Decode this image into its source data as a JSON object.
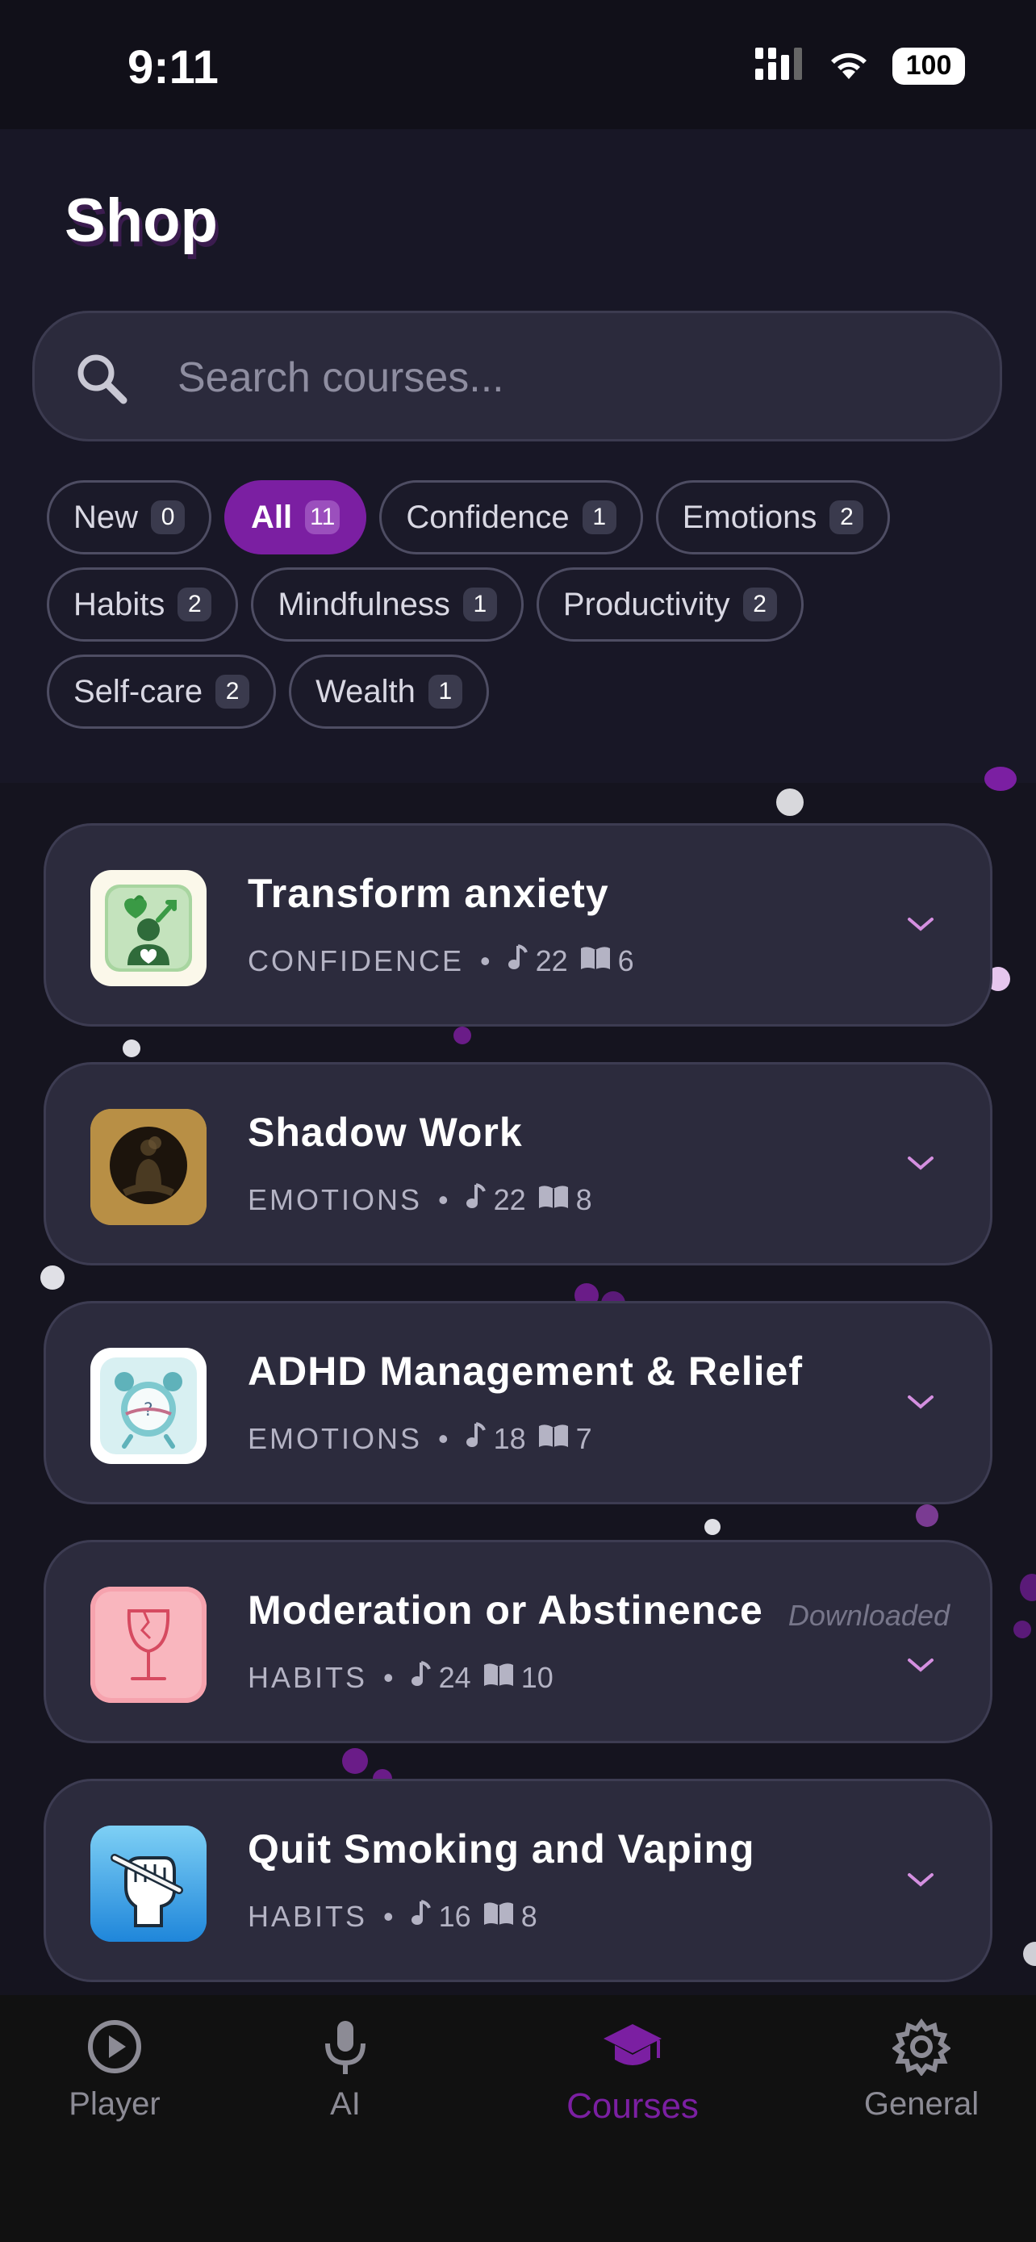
{
  "status_bar": {
    "time": "9:11",
    "battery": "100"
  },
  "page": {
    "title": "Shop"
  },
  "search": {
    "placeholder": "Search courses..."
  },
  "filters": [
    {
      "label": "New",
      "count": "0",
      "active": false
    },
    {
      "label": "All",
      "count": "11",
      "active": true
    },
    {
      "label": "Confidence",
      "count": "1",
      "active": false
    },
    {
      "label": "Emotions",
      "count": "2",
      "active": false
    },
    {
      "label": "Habits",
      "count": "2",
      "active": false
    },
    {
      "label": "Mindfulness",
      "count": "1",
      "active": false
    },
    {
      "label": "Productivity",
      "count": "2",
      "active": false
    },
    {
      "label": "Self-care",
      "count": "2",
      "active": false
    },
    {
      "label": "Wealth",
      "count": "1",
      "active": false
    }
  ],
  "courses": [
    {
      "name": "Transform anxiety",
      "category": "CONFIDENCE",
      "audio": "22",
      "reads": "6",
      "icon": "heart-growth-icon",
      "status": ""
    },
    {
      "name": "Shadow Work",
      "category": "EMOTIONS",
      "audio": "22",
      "reads": "8",
      "icon": "meditation-shadow-icon",
      "status": ""
    },
    {
      "name": "ADHD Management & Relief",
      "category": "EMOTIONS",
      "audio": "18",
      "reads": "7",
      "icon": "alarm-clock-icon",
      "status": ""
    },
    {
      "name": "Moderation or Abstinence",
      "category": "HABITS",
      "audio": "24",
      "reads": "10",
      "icon": "broken-wine-glass-icon",
      "status": "Downloaded"
    },
    {
      "name": "Quit Smoking and Vaping",
      "category": "HABITS",
      "audio": "16",
      "reads": "8",
      "icon": "fist-cigarette-icon",
      "status": ""
    }
  ],
  "tabs": [
    {
      "label": "Player",
      "icon": "play-circle-icon",
      "active": false
    },
    {
      "label": "AI",
      "icon": "microphone-icon",
      "active": false
    },
    {
      "label": "Courses",
      "icon": "graduation-cap-icon",
      "active": true
    },
    {
      "label": "General",
      "icon": "gear-icon",
      "active": false
    }
  ],
  "colors": {
    "accent": "#7b1fa2",
    "background": "#15141f",
    "card": "#2c2b3d"
  }
}
